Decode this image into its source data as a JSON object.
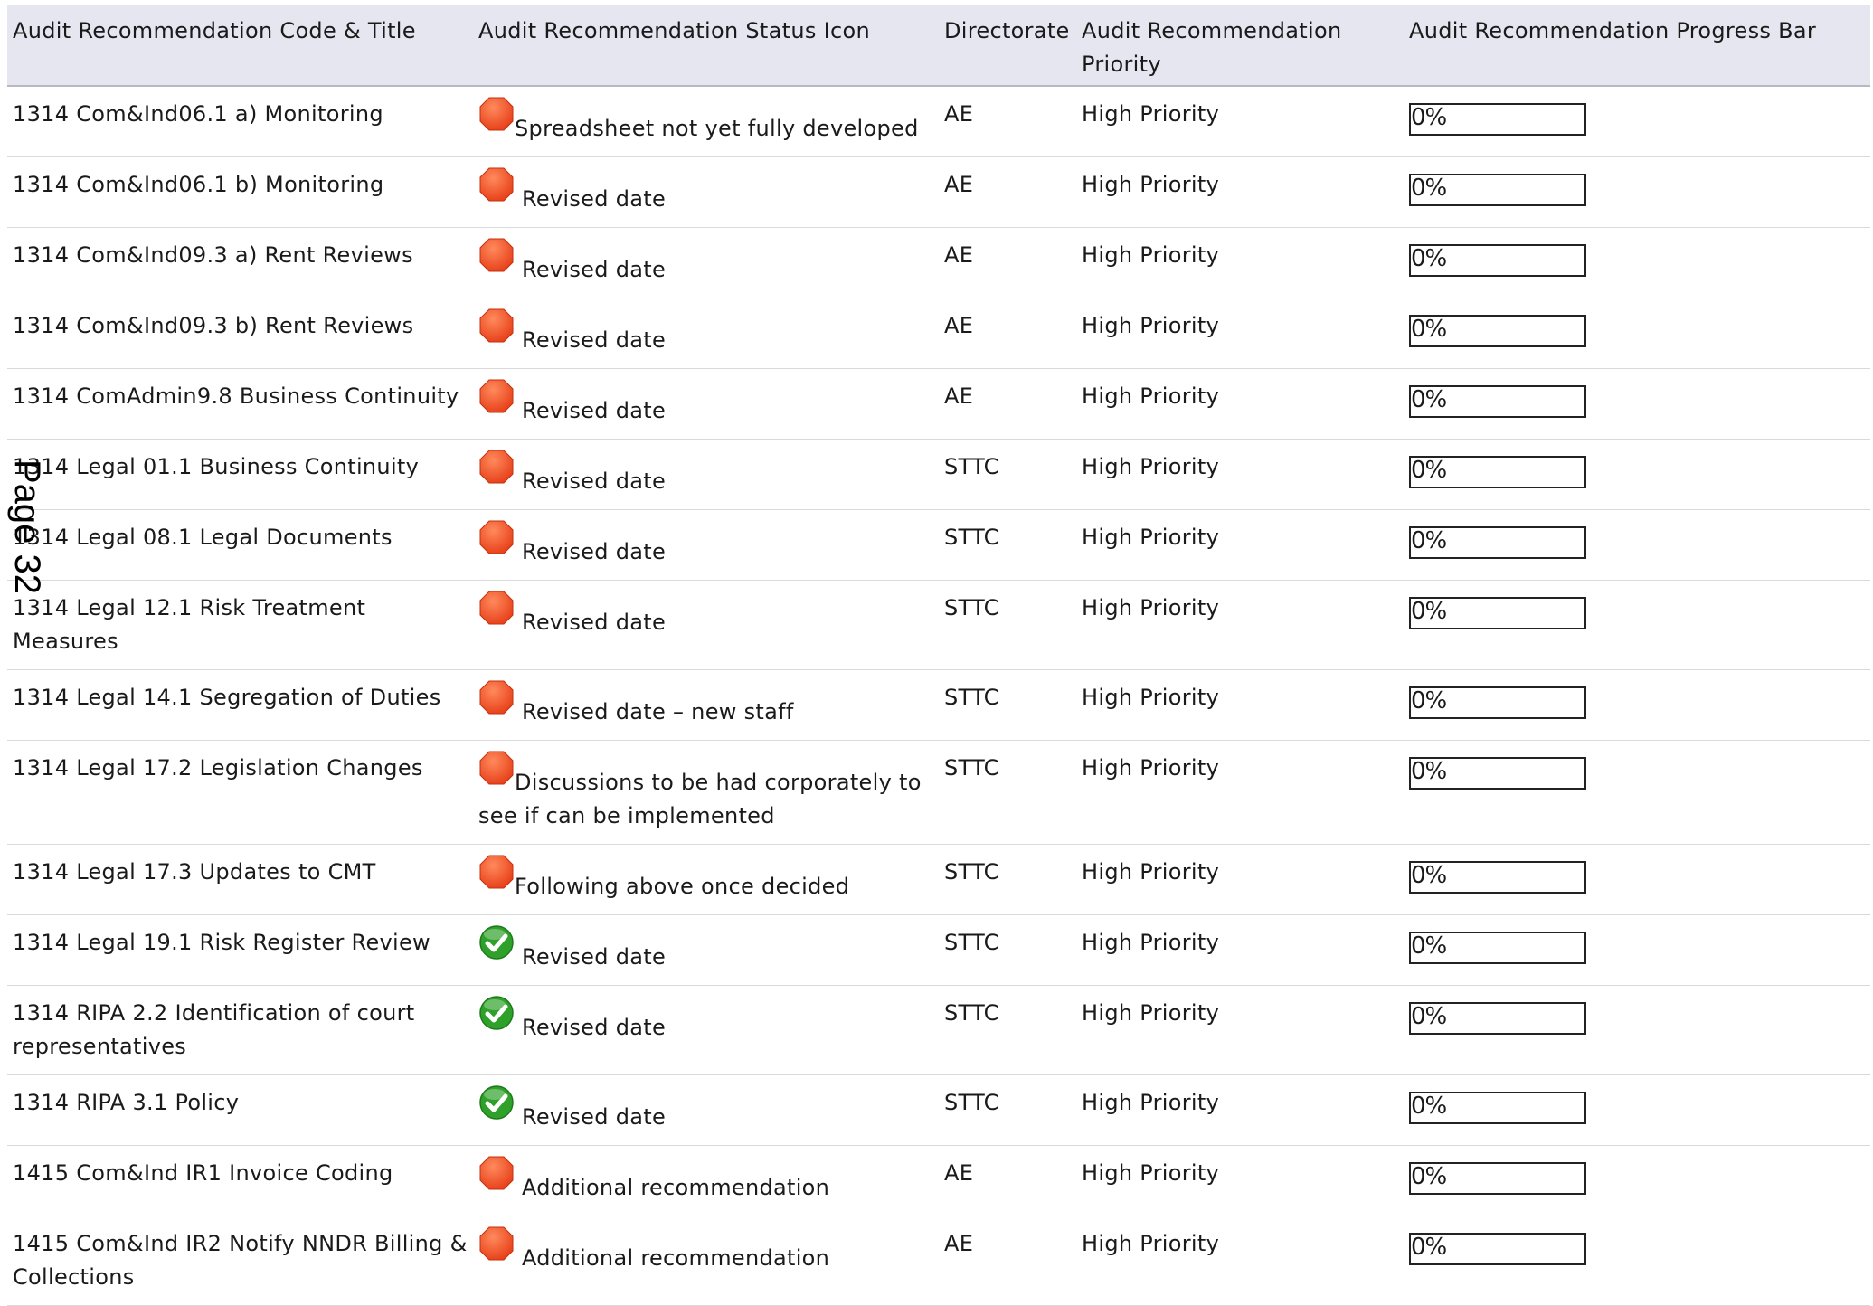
{
  "headers": {
    "title": "Audit Recommendation Code & Title",
    "status": "Audit Recommendation Status Icon",
    "directorate": "Directorate",
    "priority": "Audit Recommendation Priority",
    "progress": "Audit Recommendation Progress Bar"
  },
  "page_marker": "Page 32",
  "status_colors": {
    "red": "#e8431c",
    "green": "#2fa12a"
  },
  "rows": [
    {
      "title": "1314 Com&Ind06.1 a) Monitoring",
      "status_icon": "red-octagon-icon",
      "status_text": "Spreadsheet not yet fully developed",
      "directorate": "AE",
      "priority": "High Priority",
      "progress_label": "0%",
      "progress_value": 0
    },
    {
      "title": "1314 Com&Ind06.1 b) Monitoring",
      "status_icon": "red-octagon-icon",
      "status_text": " Revised date",
      "directorate": "AE",
      "priority": "High Priority",
      "progress_label": "0%",
      "progress_value": 0
    },
    {
      "title": "1314 Com&Ind09.3 a) Rent Reviews",
      "status_icon": "red-octagon-icon",
      "status_text": " Revised date",
      "directorate": "AE",
      "priority": "High Priority",
      "progress_label": "0%",
      "progress_value": 0
    },
    {
      "title": "1314 Com&Ind09.3 b) Rent Reviews",
      "status_icon": "red-octagon-icon",
      "status_text": " Revised date",
      "directorate": "AE",
      "priority": "High Priority",
      "progress_label": "0%",
      "progress_value": 0
    },
    {
      "title": "1314 ComAdmin9.8 Business Continuity",
      "status_icon": "red-octagon-icon",
      "status_text": " Revised date",
      "directorate": "AE",
      "priority": "High Priority",
      "progress_label": "0%",
      "progress_value": 0
    },
    {
      "title": "1314 Legal 01.1 Business Continuity",
      "status_icon": "red-octagon-icon",
      "status_text": " Revised date",
      "directorate": "STTC",
      "priority": "High Priority",
      "progress_label": "0%",
      "progress_value": 0
    },
    {
      "title": "1314 Legal 08.1 Legal Documents",
      "status_icon": "red-octagon-icon",
      "status_text": " Revised date",
      "directorate": "STTC",
      "priority": "High Priority",
      "progress_label": "0%",
      "progress_value": 0
    },
    {
      "title": "1314 Legal 12.1 Risk Treatment Measures",
      "status_icon": "red-octagon-icon",
      "status_text": " Revised date",
      "directorate": "STTC",
      "priority": "High Priority",
      "progress_label": "0%",
      "progress_value": 0
    },
    {
      "title": "1314 Legal 14.1 Segregation of Duties",
      "status_icon": "red-octagon-icon",
      "status_text": " Revised date – new staff",
      "directorate": "STTC",
      "priority": "High Priority",
      "progress_label": "0%",
      "progress_value": 0
    },
    {
      "title": "1314 Legal 17.2 Legislation Changes",
      "status_icon": "red-octagon-icon",
      "status_text": "Discussions to be had corporately to see if can be implemented",
      "directorate": "STTC",
      "priority": "High Priority",
      "progress_label": "0%",
      "progress_value": 0
    },
    {
      "title": "1314 Legal 17.3 Updates to CMT",
      "status_icon": "red-octagon-icon",
      "status_text": "Following above once decided",
      "directorate": "STTC",
      "priority": "High Priority",
      "progress_label": "0%",
      "progress_value": 0
    },
    {
      "title": "1314 Legal 19.1 Risk Register Review",
      "status_icon": "green-check-icon",
      "status_text": " Revised date",
      "directorate": "STTC",
      "priority": "High Priority",
      "progress_label": "0%",
      "progress_value": 0
    },
    {
      "title": "1314 RIPA 2.2 Identification of court representatives",
      "status_icon": "green-check-icon",
      "status_text": " Revised date",
      "directorate": "STTC",
      "priority": "High Priority",
      "progress_label": "0%",
      "progress_value": 0
    },
    {
      "title": "1314 RIPA 3.1 Policy",
      "status_icon": "green-check-icon",
      "status_text": " Revised date",
      "directorate": "STTC",
      "priority": "High Priority",
      "progress_label": "0%",
      "progress_value": 0
    },
    {
      "title": "1415 Com&Ind IR1 Invoice Coding",
      "status_icon": "red-octagon-icon",
      "status_text": " Additional recommendation",
      "directorate": "AE",
      "priority": "High Priority",
      "progress_label": "0%",
      "progress_value": 0
    },
    {
      "title": "1415 Com&Ind IR2 Notify NNDR Billing & Collections",
      "status_icon": "red-octagon-icon",
      "status_text": " Additional recommendation",
      "directorate": "AE",
      "priority": "High Priority",
      "progress_label": "0%",
      "progress_value": 0
    }
  ]
}
